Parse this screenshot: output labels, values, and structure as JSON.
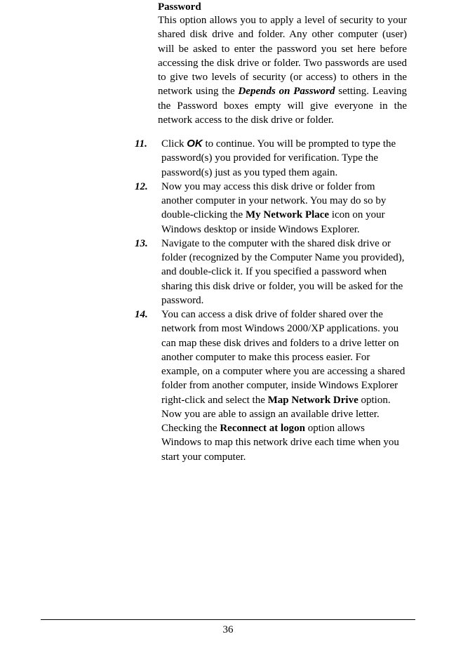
{
  "content": {
    "heading": "Password",
    "paragraph": {
      "pre": "This option allows you to apply a level of security to your shared disk drive and folder.  Any other computer (user) will be asked to enter the password you set here before accessing the disk drive or folder.  Two passwords are used to give two levels of security (or access) to others in the network using the ",
      "emph": "Depends on Password",
      "post": " setting.  Leaving the Password boxes empty will give everyone in the network access to the disk drive or folder."
    }
  },
  "steps": {
    "s11": {
      "num": "11.",
      "pre": "Click ",
      "ok": "OK",
      "post": " to continue.  You will be prompted to type the password(s) you provided for verification.  Type the password(s) just as you typed them again."
    },
    "s12": {
      "num": "12.",
      "pre": "Now you may access this disk drive or folder from another computer in your network.  You may do so by double-clicking the ",
      "b1": "My Network Place",
      "post": " icon on your Windows desktop or inside Windows Explorer."
    },
    "s13": {
      "num": "13.",
      "text": "Navigate to the computer with the shared disk drive or folder (recognized by the Computer Name you provided), and double-click it.  If you specified a password when sharing this disk drive or folder, you will be asked for the password."
    },
    "s14": {
      "num": "14.",
      "t1": "You can access a disk drive of folder shared over the network from most Windows 2000/XP applications.  you can map these disk drives and folders to a drive letter on another computer to make this process easier.  For example, on a computer where you are accessing a shared folder from another computer, inside Windows Explorer right-click and select the ",
      "b1": "Map Network Drive",
      "t2": " option.  Now you are able to assign an available drive letter.  Checking the ",
      "b2": "Reconnect at logon",
      "t3": " option allows Windows to map this network drive each time when you start your computer."
    }
  },
  "footer": {
    "page_number": "36"
  }
}
